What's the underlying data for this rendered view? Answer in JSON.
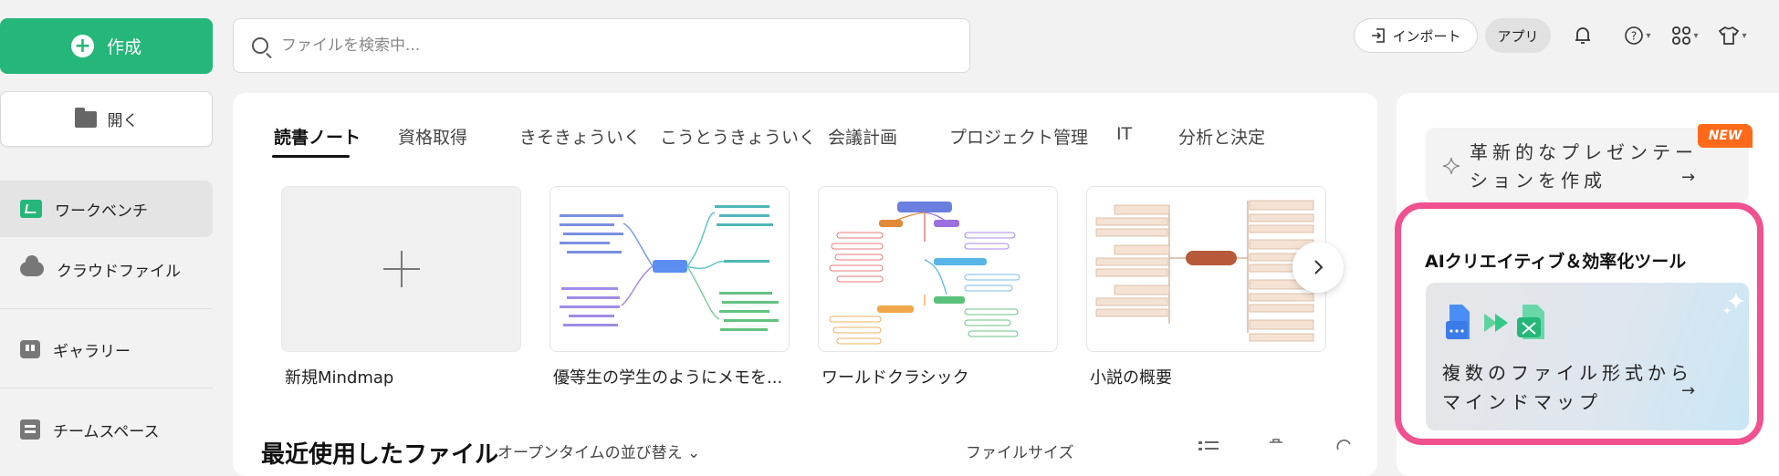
{
  "sidebar": {
    "create_label": "作成",
    "open_label": "開く",
    "items": [
      {
        "label": "ワークベンチ",
        "icon": "workbench-icon"
      },
      {
        "label": "クラウドファイル",
        "icon": "cloud-icon"
      },
      {
        "label": "ギャラリー",
        "icon": "gallery-icon"
      },
      {
        "label": "チームスペース",
        "icon": "team-icon"
      }
    ]
  },
  "topbar": {
    "search_placeholder": "ファイルを検索中...",
    "import_label": "インポート",
    "app_label": "アプリ"
  },
  "main": {
    "tabs": [
      "読書ノート",
      "資格取得",
      "きそきょういく",
      "こうとうきょういく",
      "会議計画",
      "プロジェクト管理",
      "IT",
      "分析と決定"
    ],
    "active_tab": "読書ノート",
    "templates": [
      "新規Mindmap",
      "優等生の学生のようにメモを...",
      "ワールドクラシック",
      "小説の概要"
    ],
    "recent_title": "最近使用したファイル",
    "sort_label": "オープンタイムの並び替え ⌄",
    "size_label": "ファイルサイズ"
  },
  "right": {
    "promo_text": "革新的なプレゼンテーションを作成",
    "new_badge": "NEW",
    "ai_title": "AIクリエイティブ＆効率化ツール",
    "ai_card_text": "複数のファイル形式からマインドマップ",
    "arrow": "→"
  },
  "colors": {
    "accent": "#25b77a",
    "highlight": "#f0518f",
    "badge": "#ff6a1a"
  }
}
